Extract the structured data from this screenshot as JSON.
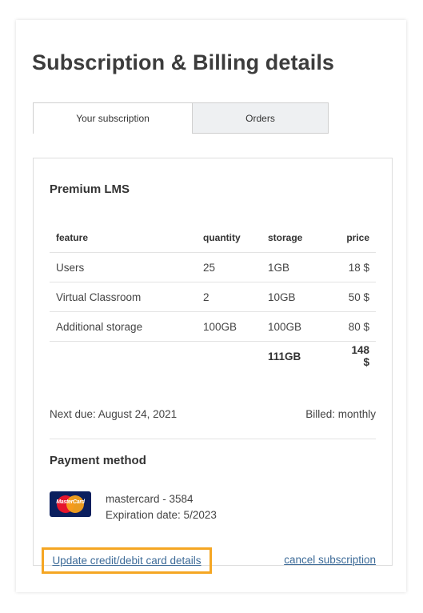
{
  "page_title": "Subscription & Billing details",
  "tabs": [
    {
      "label": "Your subscription",
      "active": true
    },
    {
      "label": "Orders",
      "active": false
    }
  ],
  "plan": {
    "title": "Premium LMS",
    "columns": {
      "feature": "feature",
      "quantity": "quantity",
      "storage": "storage",
      "price": "price"
    },
    "rows": [
      {
        "feature": "Users",
        "quantity": "25",
        "storage": "1GB",
        "price": "18 $"
      },
      {
        "feature": "Virtual Classroom",
        "quantity": "2",
        "storage": "10GB",
        "price": "50 $"
      },
      {
        "feature": "Additional storage",
        "quantity": "100GB",
        "storage": "100GB",
        "price": "80 $"
      }
    ],
    "total": {
      "storage": "111GB",
      "price": "148 $"
    }
  },
  "billing": {
    "next_due": "Next due: August 24, 2021",
    "billed": "Billed: monthly"
  },
  "payment": {
    "title": "Payment method",
    "card_brand_logo_text": "MasterCard",
    "card_label": "mastercard - 3584",
    "expiration": "Expiration date: 5/2023"
  },
  "actions": {
    "update_card": "Update credit/debit card details",
    "cancel": "cancel subscription"
  },
  "colors": {
    "highlight_border": "#f5a623",
    "link": "#3d6b98",
    "inactive_tab_bg": "#eef0f2"
  },
  "icons": {
    "card_logo": "mastercard-logo-icon"
  }
}
